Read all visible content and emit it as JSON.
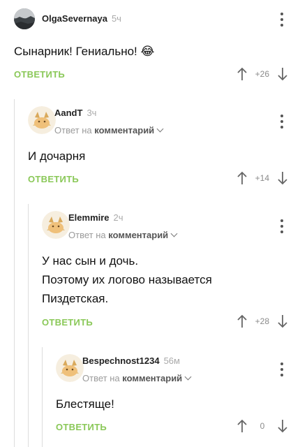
{
  "comments": [
    {
      "author": "OlgaSevernaya",
      "time": "5ч",
      "text": "Сынарник! Гениально! 😂",
      "reply_label": "ОТВЕТИТЬ",
      "rating": "+26"
    },
    {
      "author": "AandT",
      "time": "3ч",
      "reply_prefix": "Ответ на",
      "reply_target": "комментарий",
      "text": "И дочарня",
      "reply_label": "ОТВЕТИТЬ",
      "rating": "+14"
    },
    {
      "author": "Elemmire",
      "time": "2ч",
      "reply_prefix": "Ответ на",
      "reply_target": "комментарий",
      "text_lines": [
        "У нас сын и дочь.",
        "Поэтому их логово называется",
        "Пиздетская."
      ],
      "reply_label": "ОТВЕТИТЬ",
      "rating": "+28"
    },
    {
      "author": "Bespechnost1234",
      "time": "56м",
      "reply_prefix": "Ответ на",
      "reply_target": "комментарий",
      "text": "Блестяще!",
      "reply_label": "ОТВЕТИТЬ",
      "rating": "0"
    }
  ],
  "icons": {
    "menu": "kebab-icon",
    "upvote": "arrow-up-icon",
    "downvote": "arrow-down-icon",
    "expand": "chevron-down-icon",
    "avatar": "cat-avatar-icon"
  },
  "colors": {
    "accent": "#8ac858",
    "thread_line": "#dcdcdc",
    "muted": "#9a9a9a"
  }
}
